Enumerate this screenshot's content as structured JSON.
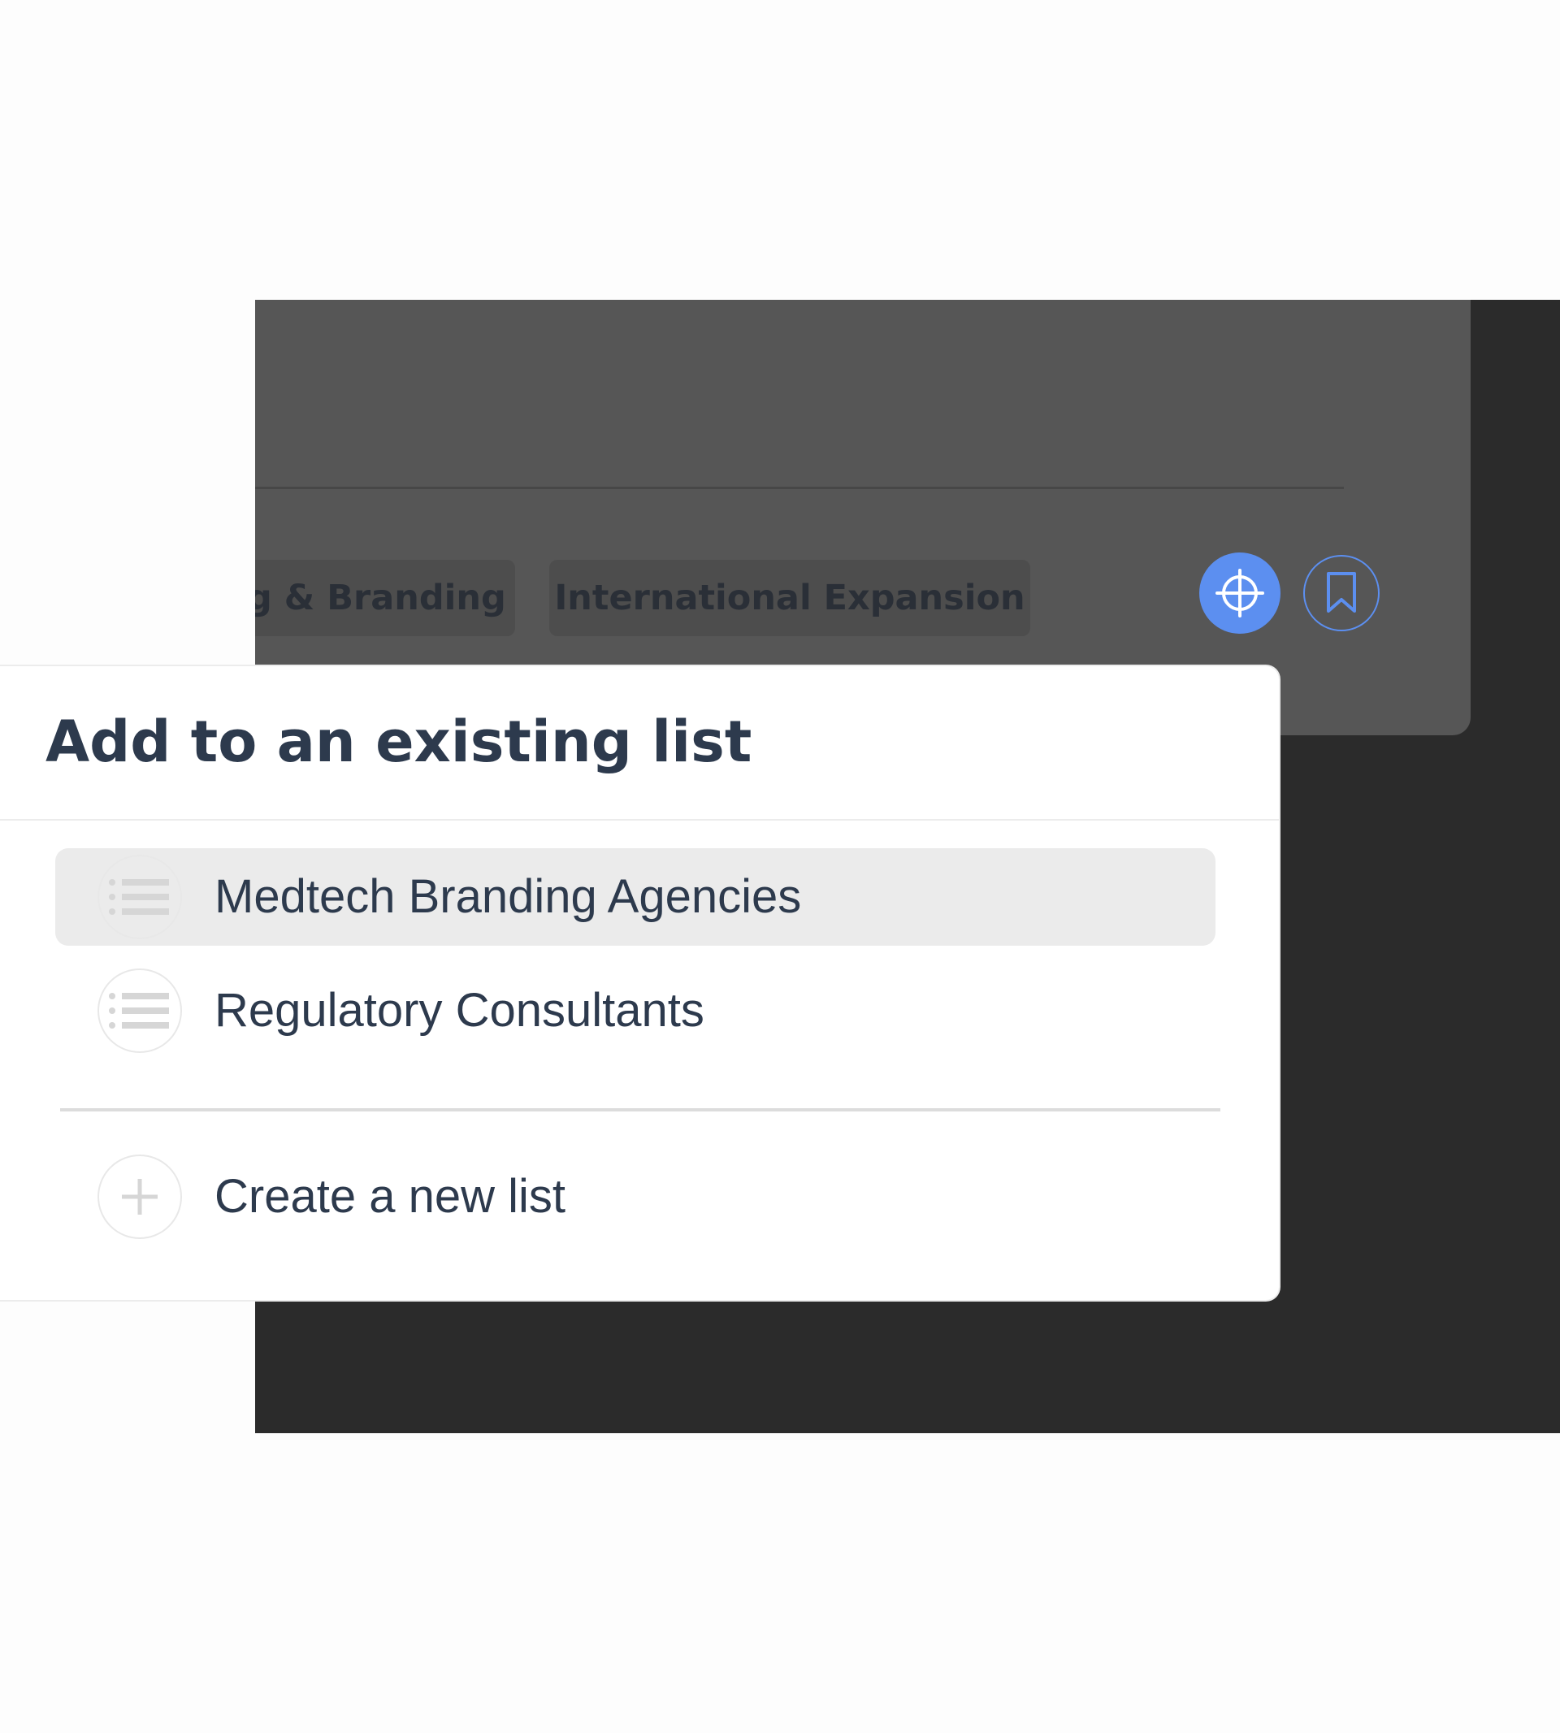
{
  "background_card": {
    "tags": [
      {
        "label": "g & Branding"
      },
      {
        "label": "International Expansion"
      }
    ],
    "actions": {
      "target_icon": "crosshair-icon",
      "bookmark_icon": "bookmark-icon"
    }
  },
  "popup": {
    "title": "Add to an existing list",
    "lists": [
      {
        "label": "Medtech Branding Agencies",
        "icon": "list-icon",
        "highlighted": true
      },
      {
        "label": "Regulatory Consultants",
        "icon": "list-icon",
        "highlighted": false
      }
    ],
    "create": {
      "label": "Create a new list",
      "icon": "plus-icon"
    }
  },
  "colors": {
    "accent": "#5c8ff0",
    "text": "#2d3a4d",
    "highlight": "#ebebeb",
    "backdrop": "#2b2b2b",
    "card": "#565656"
  }
}
